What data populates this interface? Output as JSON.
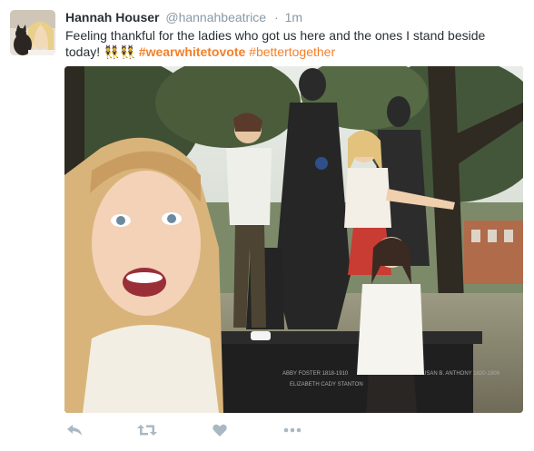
{
  "tweet": {
    "author_name": "Hannah Houser",
    "handle": "@hannahbeatrice",
    "separator": "·",
    "time": "1m",
    "text_before": "Feeling thankful for the ladies who got us here and the ones I stand beside today!",
    "emoji_1": "👯",
    "emoji_2": "👯",
    "hashtag_1": "#wearwhitetovote",
    "hashtag_2": "#bettertogether"
  },
  "photo": {
    "plaque_line_1": "ABBY FOSTER 1818-1910",
    "plaque_line_2": "ELIZABETH CADY STANTON",
    "plaque_line_3": "SUSAN B. ANTHONY 1820-1906"
  },
  "actions": [
    {
      "name": "reply"
    },
    {
      "name": "retweet"
    },
    {
      "name": "like"
    },
    {
      "name": "more"
    }
  ],
  "colors": {
    "hashtag": "#f4802a",
    "meta_text": "#8899a6",
    "action_icon": "#aab8c2",
    "body_text": "#292f33"
  }
}
